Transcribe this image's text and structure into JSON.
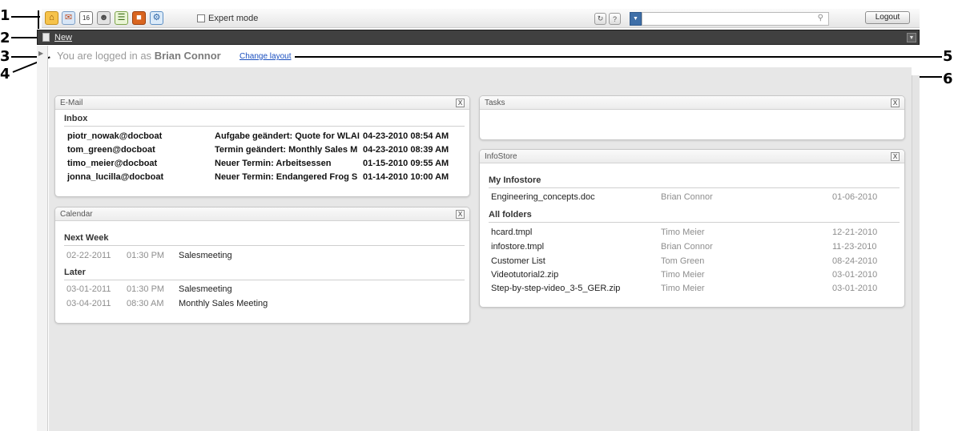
{
  "callouts": [
    "1",
    "2",
    "3",
    "4",
    "5",
    "6"
  ],
  "toolbar": {
    "icons": [
      "home-icon",
      "email-icon",
      "calendar-icon",
      "contacts-icon",
      "tasks-icon",
      "infostore-icon",
      "settings-icon"
    ],
    "expert_mode_label": "Expert mode",
    "refresh_icon": "refresh-icon",
    "help_label": "?",
    "search_placeholder": "",
    "logout_label": "Logout"
  },
  "newbar": {
    "label": "New"
  },
  "status": {
    "prefix": "You are logged in as",
    "user": "Brian Connor",
    "change_layout": "Change layout"
  },
  "email": {
    "title": "E-Mail",
    "close": "X",
    "inbox_label": "Inbox",
    "messages": [
      {
        "from": "piotr_nowak@docboat",
        "subject": "Aufgabe geändert: Quote for WLAI",
        "date": "04-23-2010 08:54 AM"
      },
      {
        "from": "tom_green@docboat",
        "subject": "Termin geändert: Monthly Sales M",
        "date": "04-23-2010 08:39 AM"
      },
      {
        "from": "timo_meier@docboat",
        "subject": "Neuer Termin: Arbeitsessen",
        "date": "01-15-2010 09:55 AM"
      },
      {
        "from": "jonna_lucilla@docboat",
        "subject": "Neuer Termin: Endangered Frog S",
        "date": "01-14-2010 10:00 AM"
      }
    ]
  },
  "calendar": {
    "title": "Calendar",
    "close": "X",
    "next_week_label": "Next Week",
    "later_label": "Later",
    "next_week": [
      {
        "date": "02-22-2011",
        "time": "01:30 PM",
        "title": "Salesmeeting"
      }
    ],
    "later": [
      {
        "date": "03-01-2011",
        "time": "01:30 PM",
        "title": "Salesmeeting"
      },
      {
        "date": "03-04-2011",
        "time": "08:30 AM",
        "title": "Monthly Sales Meeting"
      }
    ]
  },
  "tasks": {
    "title": "Tasks",
    "close": "X"
  },
  "infostore": {
    "title": "InfoStore",
    "close": "X",
    "my_infostore_label": "My Infostore",
    "all_folders_label": "All folders",
    "my_files": [
      {
        "name": "Engineering_concepts.doc",
        "owner": "Brian Connor",
        "date": "01-06-2010"
      }
    ],
    "all_files": [
      {
        "name": "hcard.tmpl",
        "owner": "Timo Meier",
        "date": "12-21-2010"
      },
      {
        "name": "infostore.tmpl",
        "owner": "Brian Connor",
        "date": "11-23-2010"
      },
      {
        "name": "Customer List",
        "owner": "Tom Green",
        "date": "08-24-2010"
      },
      {
        "name": "Videotutorial2.zip",
        "owner": "Timo Meier",
        "date": "03-01-2010"
      },
      {
        "name": "Step-by-step-video_3-5_GER.zip",
        "owner": "Timo Meier",
        "date": "03-01-2010"
      }
    ]
  },
  "colors": {
    "newbar_bg": "#404040",
    "link": "#1a4fbf",
    "main_bg": "#e7e7e7",
    "search_dropdown": "#3f6fa8"
  }
}
